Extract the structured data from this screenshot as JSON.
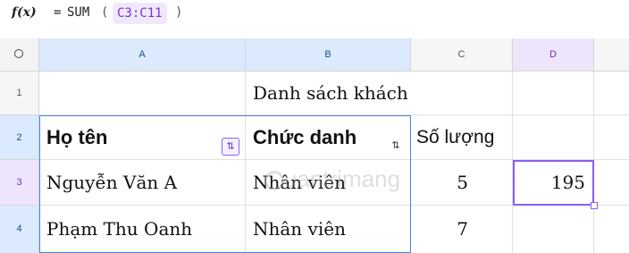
{
  "formula_bar": {
    "fx_label": "f(x)",
    "equals": "=",
    "function": "SUM",
    "open_paren": "(",
    "range_ref": "C3:C11",
    "close_paren": ")"
  },
  "columns": [
    "A",
    "B",
    "C",
    "D"
  ],
  "rows": [
    "1",
    "2",
    "3",
    "4"
  ],
  "cells": {
    "B1": "Danh sách khách",
    "A2": "Họ tên",
    "B2": "Chức danh",
    "C2": "Số lượng",
    "A3": "Nguyễn Văn A",
    "B3": "Nhân viên",
    "C3": "5",
    "D3": "195",
    "A4": "Phạm Thu Oanh",
    "B4": "Nhân viên",
    "C4": "7"
  },
  "sort_icon": "⇅",
  "watermark": "uantrimang",
  "colors": {
    "selection_blue": "#4a86d8",
    "active_purple": "#8b5cf6",
    "formula_ref_bg": "#f0e9fb"
  }
}
